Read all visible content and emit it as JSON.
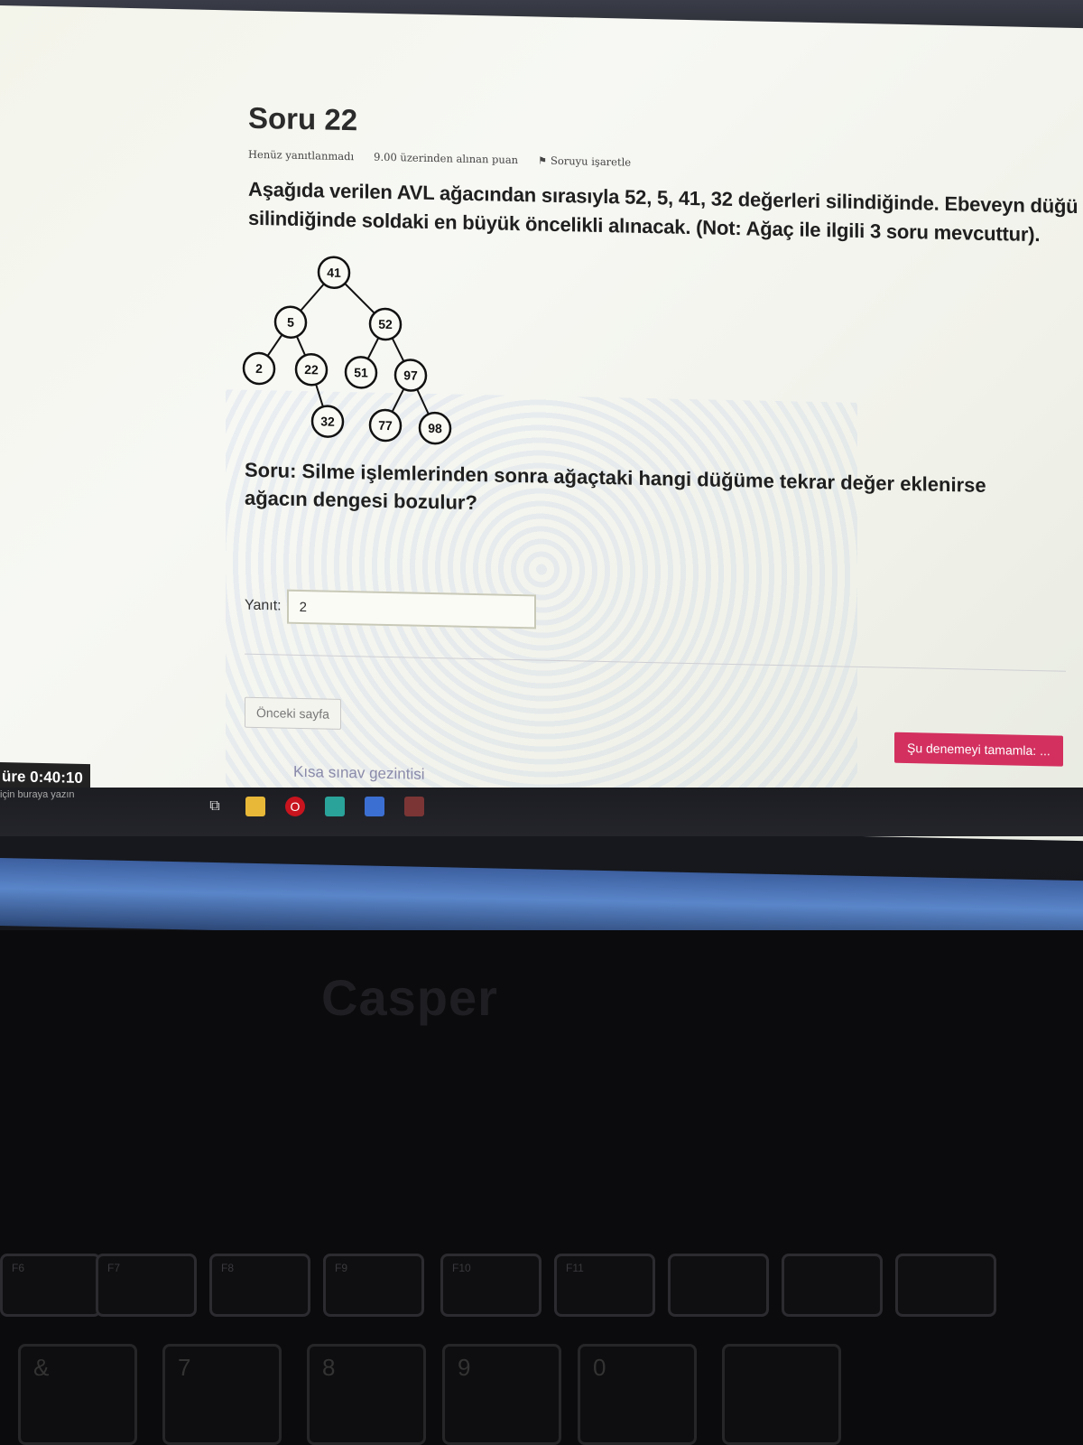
{
  "question": {
    "title": "Soru 22",
    "status": "Henüz yanıtlanmadı",
    "points": "9.00 üzerinden alınan puan",
    "flag_label": "Soruyu işaretle",
    "text_part1": "Aşağıda verilen AVL ağacından sırasıyla ",
    "text_bold": "52, 5, 41, 32",
    "text_part2": " değerleri silindiğinde. Ebeveyn düğü",
    "text_line2": "silindiğinde soldaki en büyük öncelikli alınacak. (Not: Ağaç ile ilgili 3 soru mevcuttur).",
    "soru_text": "Soru: Silme işlemlerinden sonra ağaçtaki hangi düğüme tekrar değer eklenirse ağacın dengesi bozulur?"
  },
  "tree": {
    "nodes": [
      {
        "id": "41",
        "label": "41"
      },
      {
        "id": "5",
        "label": "5"
      },
      {
        "id": "52",
        "label": "52"
      },
      {
        "id": "2",
        "label": "2"
      },
      {
        "id": "22",
        "label": "22"
      },
      {
        "id": "51",
        "label": "51"
      },
      {
        "id": "97",
        "label": "97"
      },
      {
        "id": "32",
        "label": "32"
      },
      {
        "id": "77",
        "label": "77"
      },
      {
        "id": "98",
        "label": "98"
      }
    ],
    "edges": [
      [
        "41",
        "5"
      ],
      [
        "41",
        "52"
      ],
      [
        "5",
        "2"
      ],
      [
        "5",
        "22"
      ],
      [
        "52",
        "51"
      ],
      [
        "52",
        "97"
      ],
      [
        "22",
        "32"
      ],
      [
        "97",
        "77"
      ],
      [
        "97",
        "98"
      ]
    ]
  },
  "answer": {
    "label": "Yanıt:",
    "value": "2"
  },
  "buttons": {
    "prev_label": "Önceki sayfa",
    "finish_label": "Şu denemeyi tamamla: ..."
  },
  "nav_link": "Kısa sınav gezintisi",
  "timer": "üre 0:40:10",
  "search_hint": "için buraya yazın",
  "brand": "Casper",
  "keyboard": {
    "fkeys": [
      "F6",
      "F7",
      "F8",
      "F9",
      "F10",
      "F11",
      "",
      "",
      ""
    ],
    "numkeys": [
      "&",
      "7",
      "8",
      "9",
      "0",
      ""
    ]
  },
  "colors": {
    "finish_button": "#d3305f",
    "nav_link": "#8a8aaa"
  }
}
